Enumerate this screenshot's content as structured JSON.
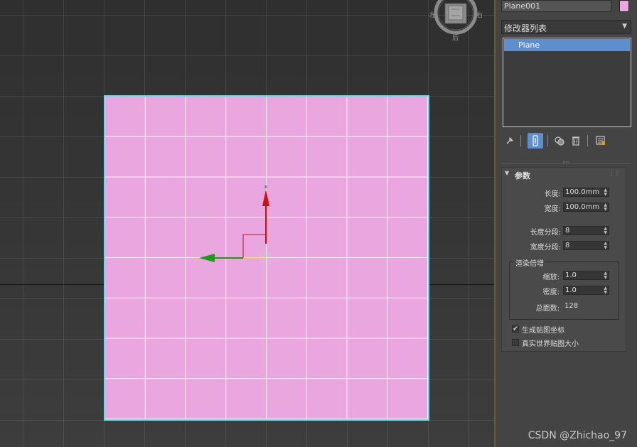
{
  "viewport": {
    "viewcube": {
      "left_label": "左",
      "right_label": "右",
      "bottom_label": "后"
    },
    "gizmo": {
      "x_axis": "x",
      "y_axis": "y"
    }
  },
  "panel": {
    "object_name": "Plane001",
    "object_color": "#eaa6de",
    "modifier_list": "修改器列表",
    "stack_items": [
      "Plane"
    ],
    "toolbar_icons": [
      "pin-icon",
      "show-end-result-icon",
      "make-unique-icon",
      "remove-modifier-icon",
      "configure-modifier-sets-icon"
    ],
    "rollout": {
      "title": "参数",
      "length_label": "长度:",
      "length_value": "100.0mm",
      "width_label": "宽度:",
      "width_value": "100.0mm",
      "length_segs_label": "长度分段:",
      "length_segs_value": "8",
      "width_segs_label": "宽度分段:",
      "width_segs_value": "8",
      "render_group_label": "渲染倍增",
      "scale_label": "缩放:",
      "scale_value": "1.0",
      "density_label": "密度:",
      "density_value": "1.0",
      "total_faces_label": "总面数:",
      "total_faces_value": "128",
      "gen_map_coords_label": "生成贴图坐标",
      "gen_map_coords_checked": true,
      "real_world_label": "真实世界贴图大小",
      "real_world_checked": false
    }
  },
  "watermark": "CSDN @Zhichao_97"
}
